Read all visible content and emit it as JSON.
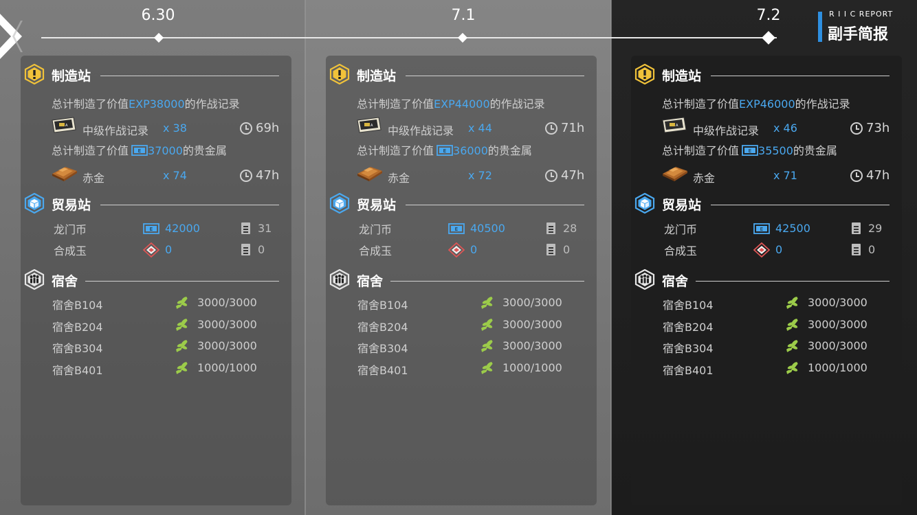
{
  "header": {
    "report_en": "R I I C REPORT",
    "report_cn": "副手简报"
  },
  "days": [
    {
      "date": "6.30",
      "manufacture": {
        "title": "制造站",
        "exp_prefix": "总计制造了价值",
        "exp_value": "EXP38000",
        "exp_suffix": "的作战记录",
        "record_name": "中级作战记录",
        "record_count": "x 38",
        "record_time": "69h",
        "gold_prefix": "总计制造了价值",
        "gold_value": "37000",
        "gold_suffix": "的贵金属",
        "gold_name": "赤金",
        "gold_count": "x 74",
        "gold_time": "47h"
      },
      "trade": {
        "title": "贸易站",
        "lmd_label": "龙门币",
        "lmd_value": "42000",
        "lmd_orders": "31",
        "orundum_label": "合成玉",
        "orundum_value": "0",
        "orundum_orders": "0"
      },
      "dorm": {
        "title": "宿舍",
        "rooms": [
          {
            "name": "宿舍B104",
            "value": "3000/3000"
          },
          {
            "name": "宿舍B204",
            "value": "3000/3000"
          },
          {
            "name": "宿舍B304",
            "value": "3000/3000"
          },
          {
            "name": "宿舍B401",
            "value": "1000/1000"
          }
        ]
      }
    },
    {
      "date": "7.1",
      "manufacture": {
        "title": "制造站",
        "exp_prefix": "总计制造了价值",
        "exp_value": "EXP44000",
        "exp_suffix": "的作战记录",
        "record_name": "中级作战记录",
        "record_count": "x 44",
        "record_time": "71h",
        "gold_prefix": "总计制造了价值",
        "gold_value": "36000",
        "gold_suffix": "的贵金属",
        "gold_name": "赤金",
        "gold_count": "x 72",
        "gold_time": "47h"
      },
      "trade": {
        "title": "贸易站",
        "lmd_label": "龙门币",
        "lmd_value": "40500",
        "lmd_orders": "28",
        "orundum_label": "合成玉",
        "orundum_value": "0",
        "orundum_orders": "0"
      },
      "dorm": {
        "title": "宿舍",
        "rooms": [
          {
            "name": "宿舍B104",
            "value": "3000/3000"
          },
          {
            "name": "宿舍B204",
            "value": "3000/3000"
          },
          {
            "name": "宿舍B304",
            "value": "3000/3000"
          },
          {
            "name": "宿舍B401",
            "value": "1000/1000"
          }
        ]
      }
    },
    {
      "date": "7.2",
      "manufacture": {
        "title": "制造站",
        "exp_prefix": "总计制造了价值",
        "exp_value": "EXP46000",
        "exp_suffix": "的作战记录",
        "record_name": "中级作战记录",
        "record_count": "x 46",
        "record_time": "73h",
        "gold_prefix": "总计制造了价值",
        "gold_value": "35500",
        "gold_suffix": "的贵金属",
        "gold_name": "赤金",
        "gold_count": "x 71",
        "gold_time": "47h"
      },
      "trade": {
        "title": "贸易站",
        "lmd_label": "龙门币",
        "lmd_value": "42500",
        "lmd_orders": "29",
        "orundum_label": "合成玉",
        "orundum_value": "0",
        "orundum_orders": "0"
      },
      "dorm": {
        "title": "宿舍",
        "rooms": [
          {
            "name": "宿舍B104",
            "value": "3000/3000"
          },
          {
            "name": "宿舍B204",
            "value": "3000/3000"
          },
          {
            "name": "宿舍B304",
            "value": "3000/3000"
          },
          {
            "name": "宿舍B401",
            "value": "1000/1000"
          }
        ]
      }
    }
  ],
  "icons": {
    "manufacture": "warning-hex-icon",
    "trade": "box-hex-icon",
    "dorm": "people-hex-icon",
    "clock": "clock-icon",
    "orders": "document-icon",
    "lmd": "lmd-currency-icon",
    "orundum": "orundum-icon",
    "morale": "leaf-morale-icon"
  },
  "colors": {
    "accent": "#4aa8ef",
    "manufacture_icon": "#f0c23a",
    "trade_icon": "#4aa8ef",
    "morale": "#9ccc4a"
  }
}
